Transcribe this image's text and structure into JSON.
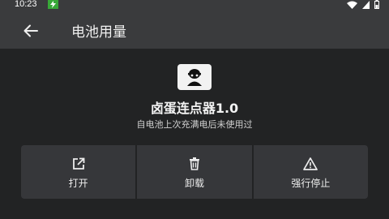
{
  "status_bar": {
    "time": "10:23"
  },
  "app_bar": {
    "title": "电池用量"
  },
  "app": {
    "name": "卤蛋连点器1.0",
    "usage_text": "自电池上次充满电后未使用过"
  },
  "actions": [
    {
      "label": "打开",
      "icon": "open-external-icon"
    },
    {
      "label": "卸载",
      "icon": "trash-icon"
    },
    {
      "label": "强行停止",
      "icon": "warning-icon"
    }
  ],
  "colors": {
    "background": "#222324",
    "app_bar": "#3a3b3d",
    "button_bg": "#36373a",
    "charge_badge": "#38a838"
  }
}
